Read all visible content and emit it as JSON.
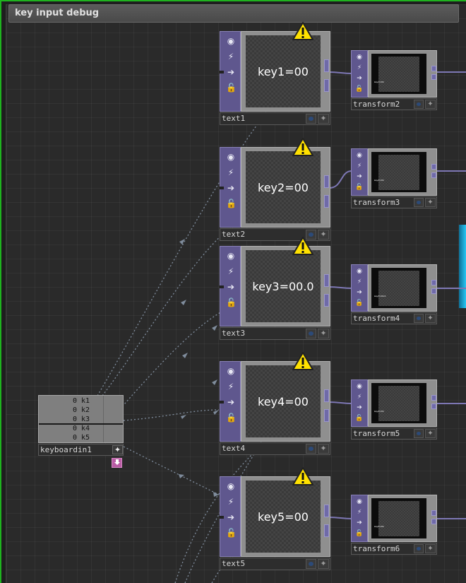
{
  "network_title": "key input debug",
  "keyboard_node": {
    "name": "keyboardin1",
    "channels": [
      "0 k1",
      "0 k2",
      "0 k3",
      "0 k4",
      "0 k5"
    ],
    "viewer_button": "✦",
    "bypass_icon": "hand-down-icon"
  },
  "text_nodes": [
    {
      "name": "text1",
      "display": "key1=00",
      "warning": true
    },
    {
      "name": "text2",
      "display": "key2=00",
      "warning": true
    },
    {
      "name": "text3",
      "display": "key3=00.0",
      "warning": true
    },
    {
      "name": "text4",
      "display": "key4=00",
      "warning": true
    },
    {
      "name": "text5",
      "display": "key5=00",
      "warning": true
    }
  ],
  "transform_nodes": [
    {
      "name": "transform2",
      "preview": "key1=00"
    },
    {
      "name": "transform3",
      "preview": "key2=00"
    },
    {
      "name": "transform4",
      "preview": "key3=00.0"
    },
    {
      "name": "transform5",
      "preview": "key4=00"
    },
    {
      "name": "transform6",
      "preview": "key5=00"
    }
  ],
  "node_flags": [
    "viewer-flag-icon",
    "cook-flag-icon",
    "render-arrow-icon",
    "lock-flag-icon"
  ],
  "colors": {
    "top_operator": "#5f578e",
    "chop_operator": "#7f7f7f",
    "selection_border": "#1fb31f",
    "warning": "#ffe100",
    "wire_top": "#7d77b4",
    "wire_export": "#8a9bb0"
  }
}
